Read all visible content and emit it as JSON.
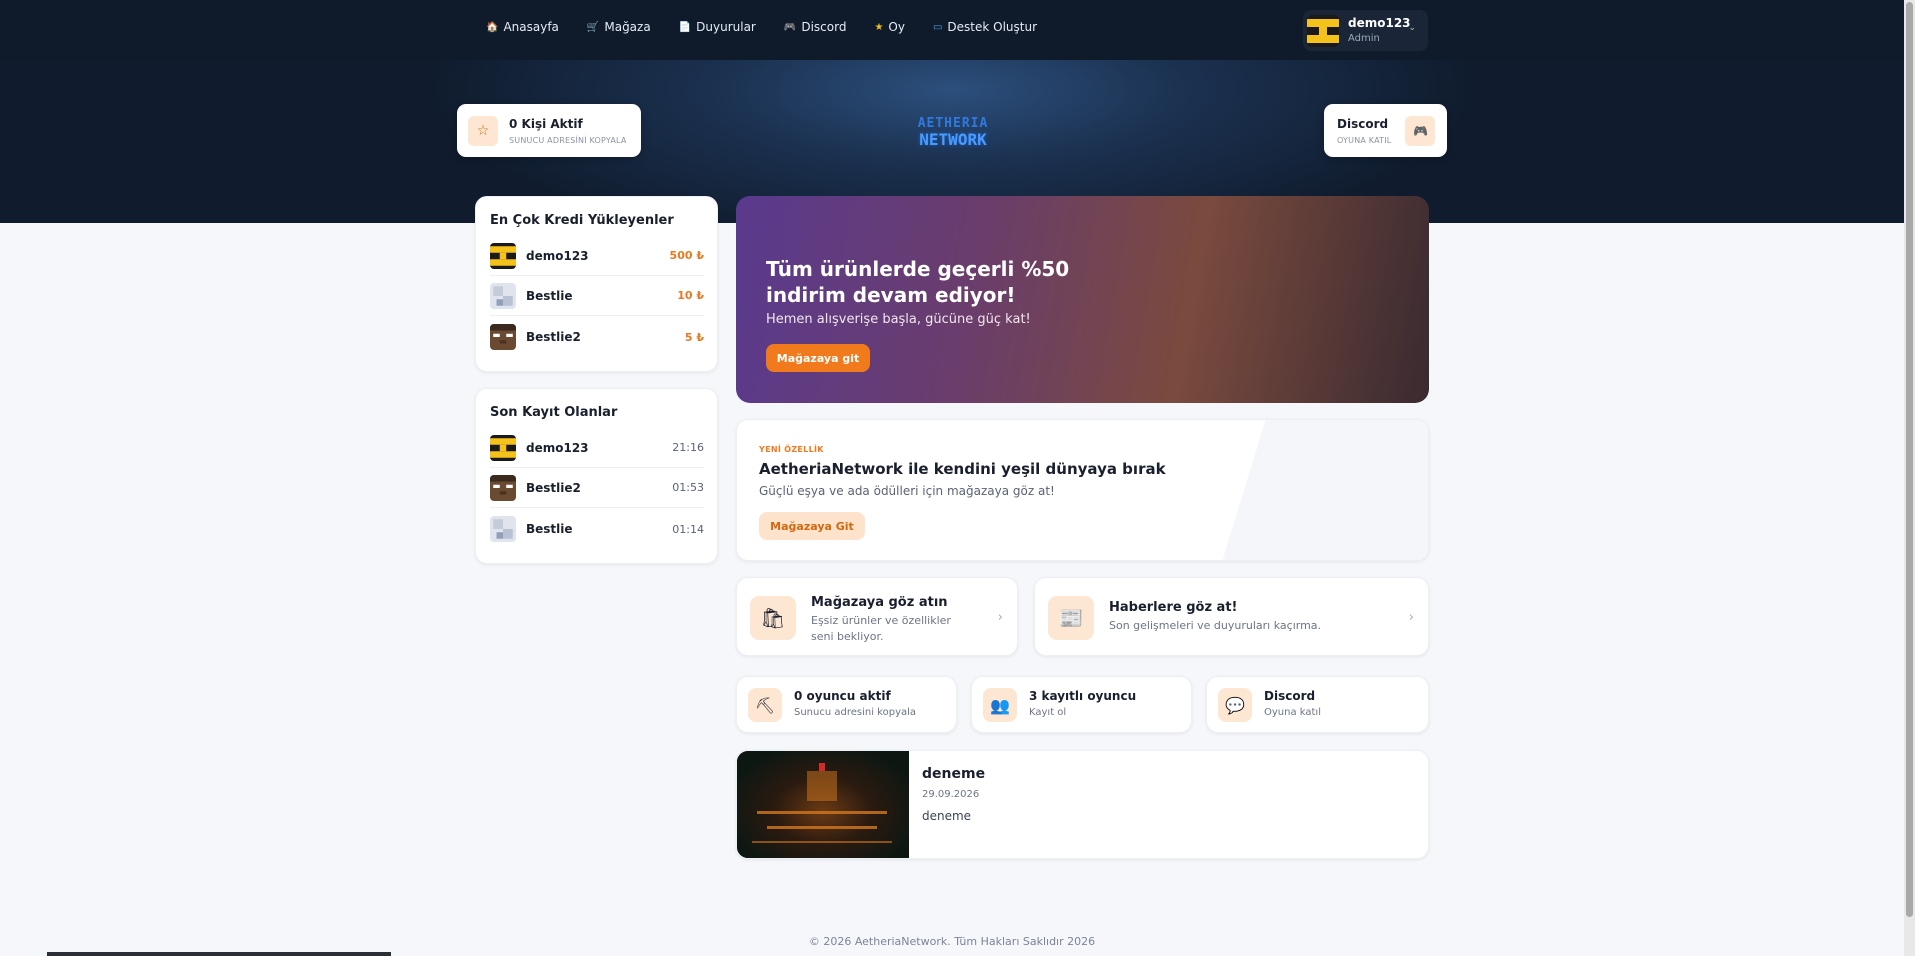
{
  "nav": {
    "items": [
      {
        "icon": "home-icon",
        "label": "Anasayfa"
      },
      {
        "icon": "cart-icon",
        "label": "Mağaza"
      },
      {
        "icon": "newspaper-icon",
        "label": "Duyurular"
      },
      {
        "icon": "gamepad-icon",
        "label": "Discord"
      },
      {
        "icon": "star-icon",
        "label": "Oy"
      },
      {
        "icon": "ticket-icon",
        "label": "Destek Oluştur"
      }
    ]
  },
  "user": {
    "name": "demo123",
    "role": "Admin"
  },
  "hero": {
    "left_pill": {
      "title": "0 Kişi Aktif",
      "sub": "SUNUCU ADRESİNİ KOPYALA"
    },
    "logo": {
      "top": "AETHERIA",
      "bottom": "NETWORK"
    },
    "right_pill": {
      "title": "Discord",
      "sub": "OYUNA KATIL"
    }
  },
  "top_credit": {
    "title": "En Çok Kredi Yükleyenler",
    "rows": [
      {
        "name": "demo123",
        "value": "500 ₺"
      },
      {
        "name": "Bestlie",
        "value": "10 ₺"
      },
      {
        "name": "Bestlie2",
        "value": "5 ₺"
      }
    ]
  },
  "recent_signups": {
    "title": "Son Kayıt Olanlar",
    "rows": [
      {
        "name": "demo123",
        "time": "21:16"
      },
      {
        "name": "Bestlie2",
        "time": "01:53"
      },
      {
        "name": "Bestlie",
        "time": "01:14"
      }
    ]
  },
  "banner": {
    "title": "Tüm ürünlerde geçerli %50 indirim devam ediyor!",
    "sub": "Hemen alışverişe başla, gücüne güç kat!",
    "button": "Mağazaya git"
  },
  "feature": {
    "tag": "YENİ ÖZELLİK",
    "title": "AetheriaNetwork ile kendini yeşil dünyaya bırak",
    "sub": "Güçlü eşya ve ada ödülleri için mağazaya göz at!",
    "button": "Mağazaya Git"
  },
  "links": [
    {
      "title": "Mağazaya göz atın",
      "sub": "Eşsiz ürünler ve özellikler seni bekliyor."
    },
    {
      "title": "Haberlere göz at!",
      "sub": "Son gelişmeleri ve duyuruları kaçırma."
    }
  ],
  "mini_stats": [
    {
      "icon": "pickaxe-icon",
      "title": "0 oyuncu aktif",
      "sub": "Sunucu adresini kopyala"
    },
    {
      "icon": "users-icon",
      "title": "3 kayıtlı oyuncu",
      "sub": "Kayıt ol"
    },
    {
      "icon": "chat-icon",
      "title": "Discord",
      "sub": "Oyuna katıl"
    }
  ],
  "news": {
    "title": "deneme",
    "date": "29.09.2026",
    "body": "deneme"
  },
  "footer": "© 2026 AetheriaNetwork. Tüm Hakları Saklıdır 2026",
  "colors": {
    "accent": "#f07a1c",
    "nav_bg": "#0f1a2b"
  }
}
